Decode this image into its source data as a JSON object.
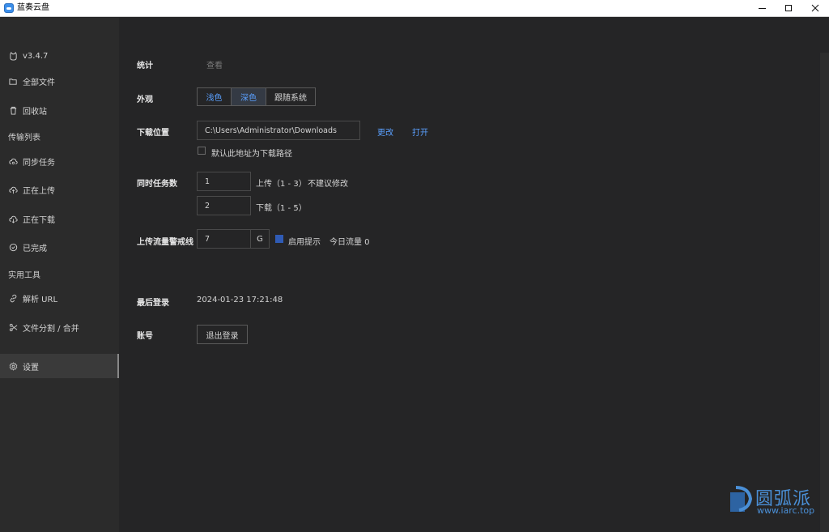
{
  "window": {
    "title": "蓝奏云盘"
  },
  "sidebar": {
    "version": "v3.4.7",
    "items_top": [
      {
        "label": "全部文件",
        "icon": "folder-open-icon"
      },
      {
        "label": "回收站",
        "icon": "trash-icon"
      }
    ],
    "section_transfer": "传输列表",
    "items_transfer": [
      {
        "label": "同步任务",
        "icon": "cloud-sync-icon"
      },
      {
        "label": "正在上传",
        "icon": "cloud-upload-icon"
      },
      {
        "label": "正在下载",
        "icon": "cloud-download-icon"
      },
      {
        "label": "已完成",
        "icon": "check-circle-icon"
      }
    ],
    "section_tools": "实用工具",
    "items_tools": [
      {
        "label": "解析 URL",
        "icon": "link-icon"
      },
      {
        "label": "文件分割 / 合并",
        "icon": "scissors-icon"
      }
    ],
    "settings": {
      "label": "设置",
      "icon": "gear-icon"
    }
  },
  "settings": {
    "stats": {
      "label": "统计",
      "action": "查看"
    },
    "appearance": {
      "label": "外观",
      "options": [
        "浅色",
        "深色",
        "跟随系统"
      ],
      "selected": "深色"
    },
    "download_location": {
      "label": "下载位置",
      "value": "C:\\Users\\Administrator\\Downloads",
      "change": "更改",
      "open": "打开",
      "default_checkbox_label": "默认此地址为下载路径",
      "default_checked": false
    },
    "concurrency": {
      "label": "同时任务数",
      "upload_value": "1",
      "upload_label": "上传（1 - 3）",
      "upload_note": "不建议修改",
      "download_value": "2",
      "download_label": "下载（1 - 5）"
    },
    "upload_traffic": {
      "label": "上传流量警戒线",
      "value": "7",
      "unit": "G",
      "enable_label": "启用提示",
      "enable_checked": true,
      "today_label": "今日流量 0"
    },
    "last_login": {
      "label": "最后登录",
      "value": "2024-01-23 17:21:48"
    },
    "account": {
      "label": "账号",
      "logout": "退出登录"
    }
  },
  "watermark": {
    "text": "圆弧派",
    "url": "www.iarc.top"
  },
  "colors": {
    "accent": "#5aa0ff",
    "sidebar_bg": "#2b2b2b",
    "main_bg": "#252526",
    "checkbox_checked": "#2f5bb5"
  }
}
